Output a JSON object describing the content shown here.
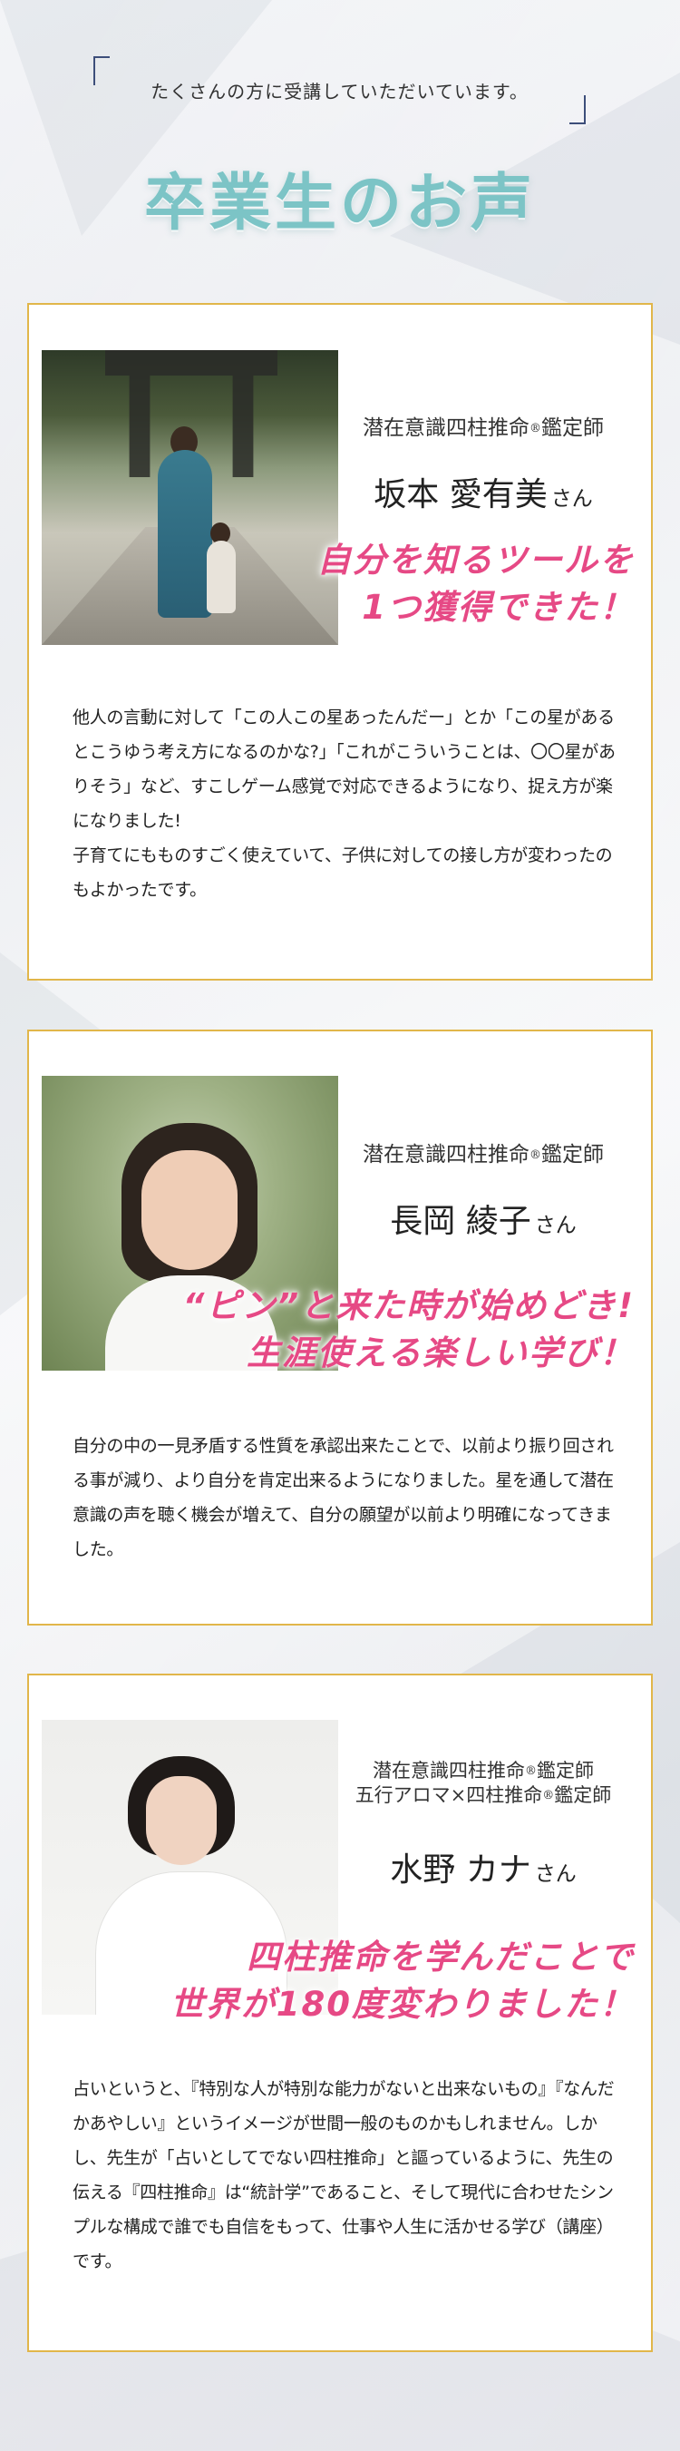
{
  "intro": "たくさんの方に受講していただいています。",
  "title": "卒業生のお声",
  "colors": {
    "title": "#7cc4c6",
    "accent_pink": "#e64985",
    "border_gold": "#e1b64a",
    "bracket": "#3d4e7a"
  },
  "testimonials": [
    {
      "role": "潜在意識四柱推命",
      "role_mark": "®",
      "role_suffix": "鑑定師",
      "name": "坂本 愛有美",
      "honorific": "さん",
      "catch_lines": [
        "自分を知るツールを",
        "1つ獲得できた！"
      ],
      "body": [
        "他人の言動に対して「この人この星あったんだー」とか「この星があるとこうゆう考え方になるのかな?」「これがこういうことは、〇〇星がありそう」など、すこしゲーム感覚で対応できるようになり、捉え方が楽になりました!",
        "子育てにもものすごく使えていて、子供に対しての接し方が変わったのもよかったです。"
      ]
    },
    {
      "role": "潜在意識四柱推命",
      "role_mark": "®",
      "role_suffix": "鑑定師",
      "name": "長岡 綾子",
      "honorific": "さん",
      "catch_lines": [
        "“ピン”と来た時が始めどき!",
        "生涯使える楽しい学び！"
      ],
      "body": [
        "自分の中の一見矛盾する性質を承認出来たことで、以前より振り回される事が減り、より自分を肯定出来るようになりました。星を通して潜在意識の声を聴く機会が増えて、自分の願望が以前より明確になってきました。"
      ]
    },
    {
      "role_lines": [
        "潜在意識四柱推命",
        "五行アロマ×四柱推命"
      ],
      "role_mark": "®",
      "role_suffix": "鑑定師",
      "name": "水野 カナ",
      "honorific": "さん",
      "catch_lines": [
        "四柱推命を学んだことで",
        "世界が180度変わりました！"
      ],
      "body": [
        "占いというと、『特別な人が特別な能力がないと出来ないもの』『なんだかあやしい』というイメージが世間一般のものかもしれません。しかし、先生が「占いとしてでない四柱推命」と謳っているように、先生の伝える『四柱推命』は“統計学”であること、そして現代に合わせたシンプルな構成で誰でも自信をもって、仕事や人生に活かせる学び（講座）です。"
      ]
    }
  ]
}
